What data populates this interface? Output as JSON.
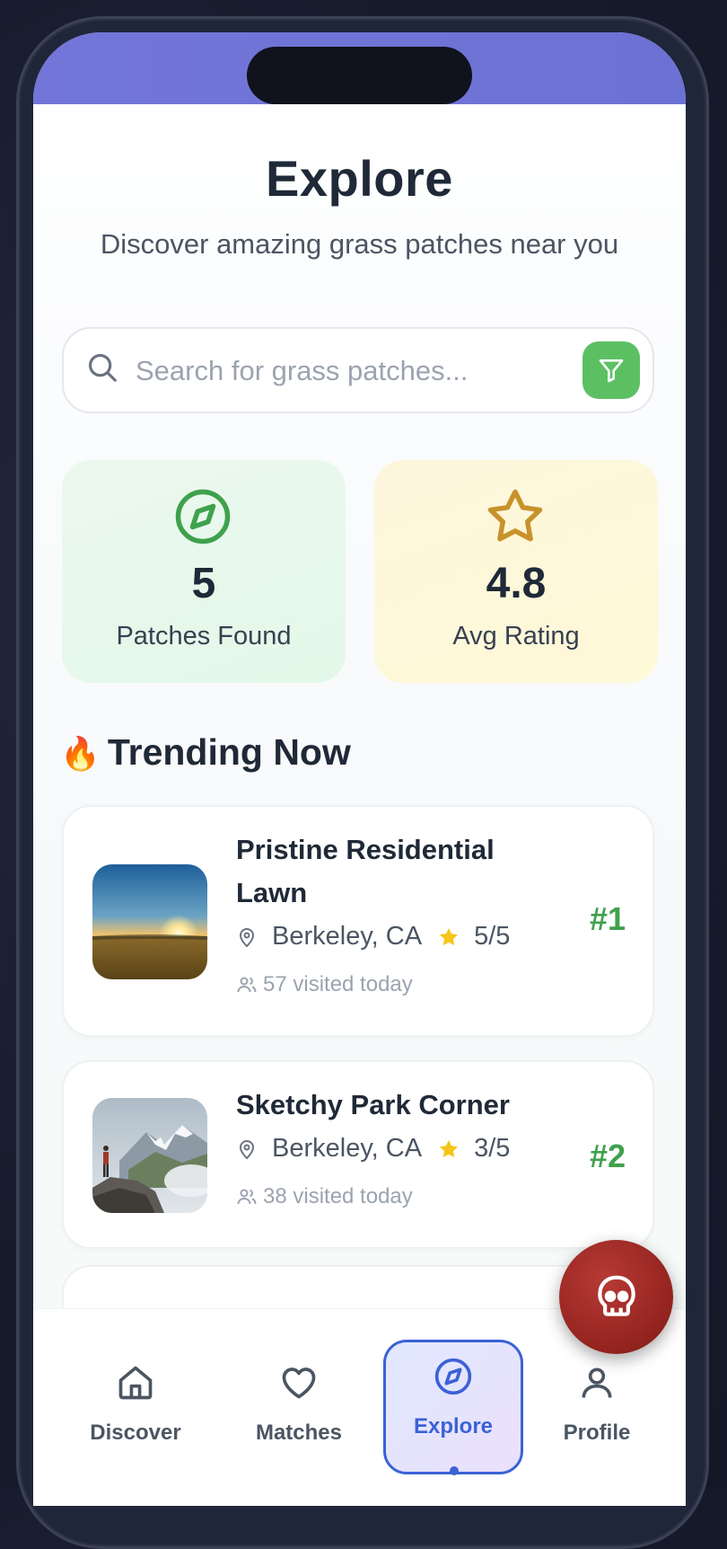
{
  "header": {
    "title": "Explore",
    "subtitle": "Discover amazing grass patches near you"
  },
  "search": {
    "placeholder": "Search for grass patches...",
    "value": ""
  },
  "stats": [
    {
      "value": "5",
      "label": "Patches Found",
      "icon": "compass-icon"
    },
    {
      "value": "4.8",
      "label": "Avg Rating",
      "icon": "star-icon"
    }
  ],
  "trending": {
    "title_emoji": "🔥",
    "title": "Trending Now",
    "items": [
      {
        "name": "Pristine Residential Lawn",
        "location": "Berkeley, CA",
        "rating": "5/5",
        "visits": "57 visited today",
        "rank": "#1",
        "image": "sunset-field"
      },
      {
        "name": "Sketchy Park Corner",
        "location": "Berkeley, CA",
        "rating": "3/5",
        "visits": "38 visited today",
        "rank": "#2",
        "image": "mountain-hiker"
      }
    ]
  },
  "nav": {
    "items": [
      {
        "label": "Discover",
        "icon": "home-icon"
      },
      {
        "label": "Matches",
        "icon": "heart-icon"
      },
      {
        "label": "Explore",
        "icon": "compass-icon",
        "active": true
      },
      {
        "label": "Profile",
        "icon": "user-icon"
      }
    ]
  },
  "fab": {
    "icon": "skull-icon"
  },
  "colors": {
    "header_gradient": "#7376d8",
    "accent_green": "#5cc063",
    "rank_green": "#3fa14d",
    "active_blue": "#3b62d6",
    "fab_red": "#93231f"
  }
}
